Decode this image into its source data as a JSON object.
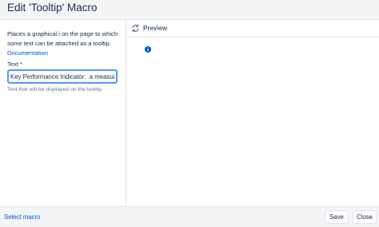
{
  "dialog": {
    "title": "Edit 'Tooltip' Macro"
  },
  "left_pane": {
    "description": "Places a graphical i on the page to which some text can be attached as a tooltip.",
    "documentation_link": "Documentation",
    "field_label": "Text *",
    "field_value": "Key Performance Indicator:  a measure",
    "help_text": "Text that will be displayed on the tooltip."
  },
  "preview": {
    "label": "Preview",
    "icons": {
      "refresh": "refresh-icon",
      "tooltip": "info-icon"
    }
  },
  "footer": {
    "select_macro_link": "Select macro",
    "save_label": "Save",
    "close_label": "Close"
  },
  "colors": {
    "link": "#0052cc",
    "info_icon": "#0052cc",
    "focus_border": "#4c9aff",
    "header_bg": "#f4f5f7"
  }
}
